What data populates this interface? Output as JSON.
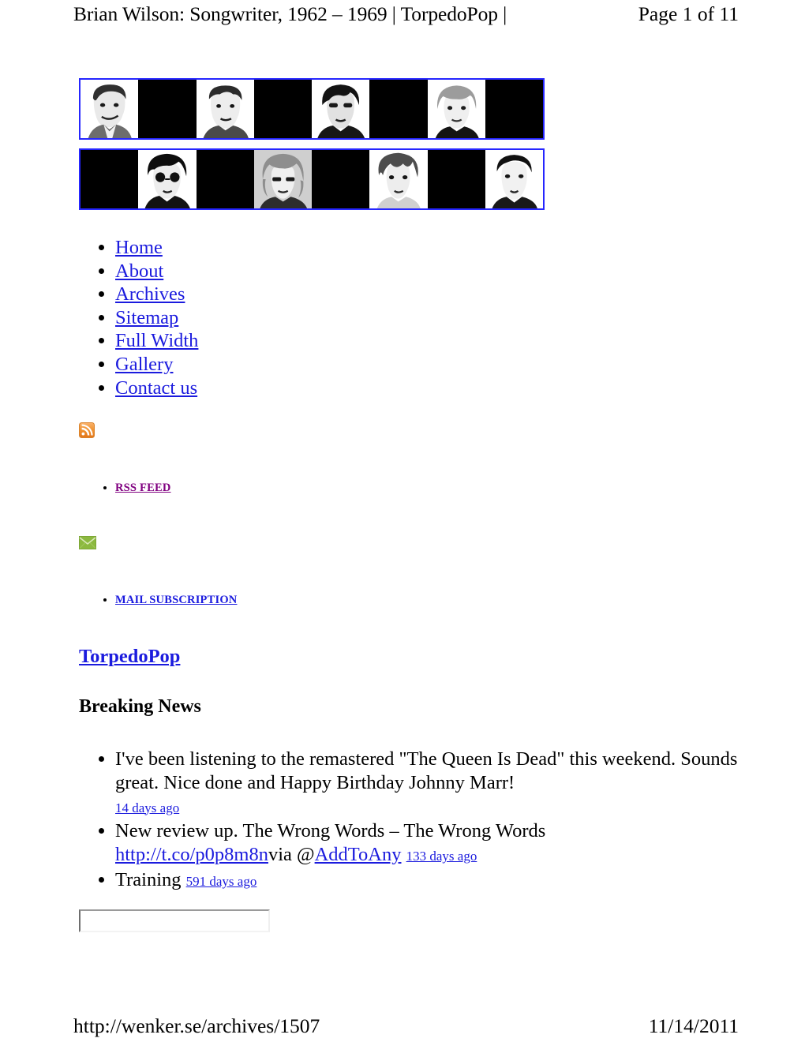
{
  "print_header": {
    "title": "Brian Wilson: Songwriter, 1962 – 1969 | TorpedoPop |",
    "page_label": "Page 1 of 11"
  },
  "banner": {
    "border_color": "#2626ff",
    "cell_background": "#000000",
    "strips": [
      {
        "name": "banner-strip-top",
        "cells": [
          {
            "type": "portrait",
            "alt": "portrait-1"
          },
          {
            "type": "blank"
          },
          {
            "type": "portrait",
            "alt": "portrait-2"
          },
          {
            "type": "blank"
          },
          {
            "type": "portrait",
            "alt": "portrait-3"
          },
          {
            "type": "blank"
          },
          {
            "type": "portrait",
            "alt": "portrait-4"
          },
          {
            "type": "blank"
          }
        ]
      },
      {
        "name": "banner-strip-bottom",
        "cells": [
          {
            "type": "blank"
          },
          {
            "type": "portrait",
            "alt": "portrait-5"
          },
          {
            "type": "blank"
          },
          {
            "type": "portrait",
            "alt": "portrait-6"
          },
          {
            "type": "blank"
          },
          {
            "type": "portrait",
            "alt": "portrait-7"
          },
          {
            "type": "blank"
          },
          {
            "type": "portrait",
            "alt": "portrait-8"
          }
        ]
      }
    ]
  },
  "nav": {
    "link_color": "#1b1bde",
    "items": [
      {
        "label": "Home"
      },
      {
        "label": "About"
      },
      {
        "label": "Archives"
      },
      {
        "label": "Sitemap"
      },
      {
        "label": "Full Width"
      },
      {
        "label": "Gallery"
      },
      {
        "label": "Contact us"
      }
    ]
  },
  "rss": {
    "icon": "rss-icon",
    "icon_color": "#f08a24",
    "label": "RSS FEED",
    "label_color": "#800080"
  },
  "mail": {
    "icon": "envelope-icon",
    "icon_color": "#86b33c",
    "label": "MAIL SUBSCRIPTION",
    "label_color": "#1b1bde"
  },
  "site": {
    "title": "TorpedoPop",
    "section_title": "Breaking News"
  },
  "news": {
    "items": [
      {
        "text": "I've been listening to the remastered \"The Queen Is Dead\" this weekend. Sounds great. Nice done and Happy Birthday Johnny Marr!",
        "ago": "14 days ago",
        "prefix": "",
        "link": "",
        "via": "",
        "handle": ""
      },
      {
        "text": "New review up. The Wrong Words – The Wrong Words",
        "link": "http://t.co/p0p8m8n",
        "via": "via @",
        "handle": "AddToAny",
        "ago": "133 days ago",
        "prefix": ""
      },
      {
        "text": "Training",
        "ago": "591 days ago",
        "prefix": "",
        "link": "",
        "via": "",
        "handle": ""
      }
    ]
  },
  "search": {
    "value": "",
    "placeholder": ""
  },
  "print_footer": {
    "url": "http://wenker.se/archives/1507",
    "date": "11/14/2011"
  }
}
